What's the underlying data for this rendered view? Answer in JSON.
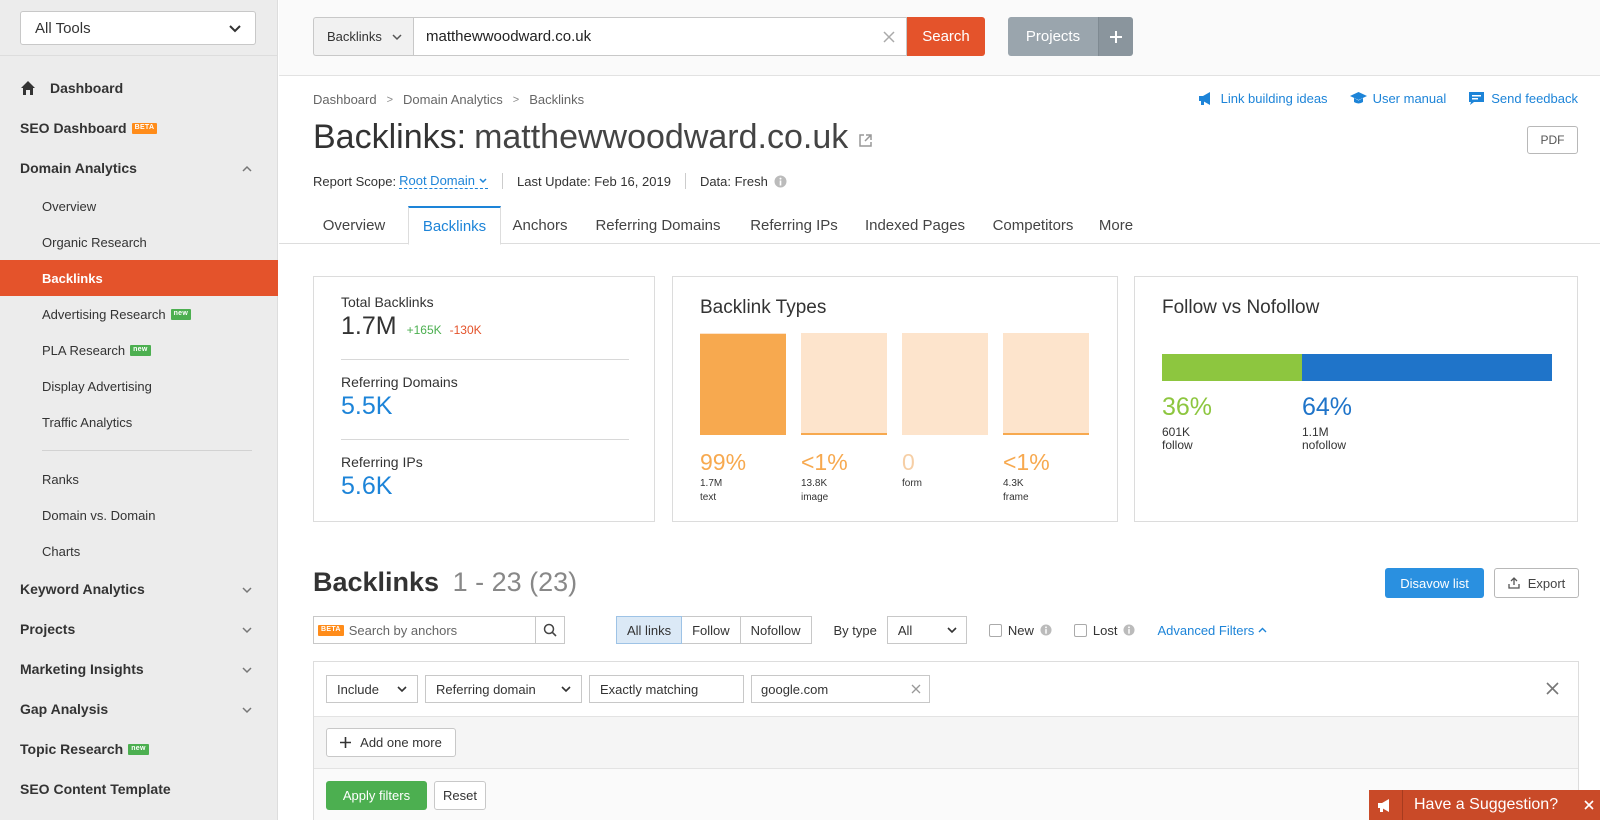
{
  "sidebar": {
    "tools_select": "All Tools",
    "items": [
      {
        "label": "Dashboard"
      },
      {
        "label": "SEO Dashboard",
        "badge": "BETA"
      },
      {
        "label": "Domain Analytics"
      }
    ],
    "sub_items": [
      {
        "label": "Overview"
      },
      {
        "label": "Organic Research"
      },
      {
        "label": "Backlinks",
        "active": true
      },
      {
        "label": "Advertising Research",
        "badge": "new"
      },
      {
        "label": "PLA Research",
        "badge": "new"
      },
      {
        "label": "Display Advertising"
      },
      {
        "label": "Traffic Analytics"
      },
      {
        "label": "Ranks"
      },
      {
        "label": "Domain vs. Domain"
      },
      {
        "label": "Charts"
      }
    ],
    "groups": [
      {
        "label": "Keyword Analytics"
      },
      {
        "label": "Projects"
      },
      {
        "label": "Marketing Insights"
      },
      {
        "label": "Gap Analysis"
      },
      {
        "label": "Topic Research",
        "badge": "new"
      },
      {
        "label": "SEO Content Template"
      }
    ]
  },
  "topbar": {
    "db_select": "Backlinks",
    "domain_value": "matthewwoodward.co.uk",
    "search_label": "Search",
    "projects_label": "Projects"
  },
  "header": {
    "breadcrumb": [
      "Dashboard",
      "Domain Analytics",
      "Backlinks"
    ],
    "help_links": [
      "Link building ideas",
      "User manual",
      "Send feedback"
    ],
    "title_prefix": "Backlinks:",
    "title_domain": "matthewwoodward.co.uk",
    "pdf_label": "PDF",
    "report_scope_label": "Report Scope:",
    "report_scope_value": "Root Domain",
    "last_update": "Last Update: Feb 16, 2019",
    "data_status": "Data: Fresh"
  },
  "tabs": [
    "Overview",
    "Backlinks",
    "Anchors",
    "Referring Domains",
    "Referring IPs",
    "Indexed Pages",
    "Competitors",
    "More"
  ],
  "active_tab": "Backlinks",
  "summary": {
    "total_backlinks_label": "Total Backlinks",
    "total_backlinks_value": "1.7M",
    "total_backlinks_up": "+165K",
    "total_backlinks_down": "-130K",
    "referring_domains_label": "Referring Domains",
    "referring_domains_value": "5.5K",
    "referring_ips_label": "Referring IPs",
    "referring_ips_value": "5.6K"
  },
  "backlink_types": {
    "title": "Backlink Types",
    "items": [
      {
        "pct": "99%",
        "count": "1.7M",
        "type": "text",
        "share": 0.99
      },
      {
        "pct": "<1%",
        "count": "13.8K",
        "type": "image",
        "share": 0.02
      },
      {
        "pct": "0",
        "count": "",
        "type": "form",
        "share": 0
      },
      {
        "pct": "<1%",
        "count": "4.3K",
        "type": "frame",
        "share": 0.02
      }
    ]
  },
  "follow": {
    "title": "Follow vs Nofollow",
    "follow_pct": "36%",
    "follow_count": "601K",
    "follow_label": "follow",
    "nofollow_pct": "64%",
    "nofollow_count": "1.1M",
    "nofollow_label": "nofollow",
    "follow_share": 0.36,
    "follow_color": "#8dc63f",
    "nofollow_color": "#1f74c9"
  },
  "table": {
    "title": "Backlinks",
    "range": "1 - 23 (23)",
    "disavow_label": "Disavow list",
    "export_label": "Export",
    "anchor_badge": "BETA",
    "anchor_placeholder": "Search by anchors",
    "link_filters": [
      "All links",
      "Follow",
      "Nofollow"
    ],
    "bytype_label": "By type",
    "bytype_value": "All",
    "new_label": "New",
    "lost_label": "Lost",
    "advanced_label": "Advanced Filters"
  },
  "filter_panel": {
    "include": "Include",
    "field": "Referring domain",
    "match": "Exactly matching",
    "value": "google.com",
    "add_more": "Add one more",
    "apply": "Apply filters",
    "reset": "Reset"
  },
  "suggestion": "Have a Suggestion?",
  "colors": {
    "accent": "#e4532b",
    "link": "#1d84d8",
    "green": "#4caf50",
    "orange": "#f7a94f"
  }
}
